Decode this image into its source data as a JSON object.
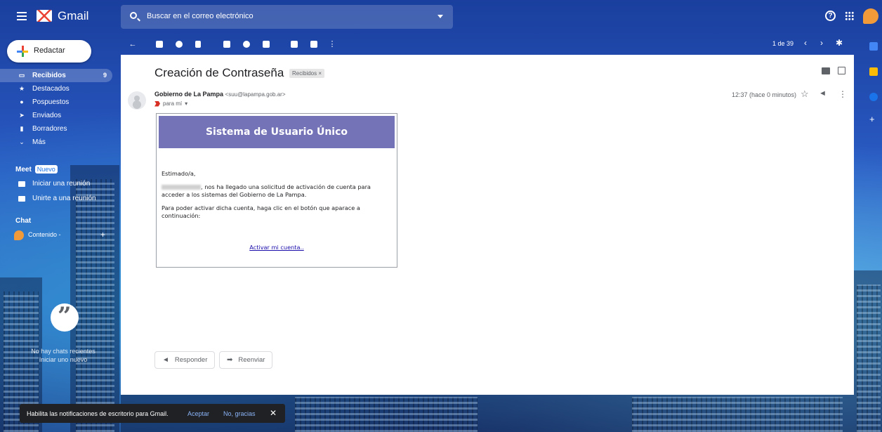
{
  "app": {
    "name": "Gmail"
  },
  "search": {
    "placeholder": "Buscar en el correo electrónico"
  },
  "sidebar": {
    "compose_label": "Redactar",
    "items": [
      {
        "label": "Recibidos",
        "count": "9",
        "icon": "inbox-icon"
      },
      {
        "label": "Destacados",
        "icon": "star-icon"
      },
      {
        "label": "Pospuestos",
        "icon": "clock-icon"
      },
      {
        "label": "Enviados",
        "icon": "send-icon"
      },
      {
        "label": "Borradores",
        "icon": "draft-icon"
      },
      {
        "label": "Más",
        "icon": "chevron-down-icon"
      }
    ],
    "meet": {
      "heading": "Meet",
      "badge": "Nuevo",
      "start": "Iniciar una reunión",
      "join": "Unirte a una reunión"
    },
    "chat": {
      "heading": "Chat",
      "user": "Contenido -",
      "add": "+",
      "empty": "No hay chats recientes",
      "start_new": "Iniciar uno nuevo"
    }
  },
  "toolbar": {
    "pager": "1 de 39",
    "prev": "‹",
    "next": "›"
  },
  "message": {
    "subject": "Creación de Contraseña",
    "label": "Recibidos ×",
    "sender_name": "Gobierno de La Pampa",
    "sender_email": "<suu@lapampa.gob.ar>",
    "recipient": "para mí",
    "time": "12:37 (hace 0 minutos)",
    "body_title": "Sistema de Usuario Único",
    "greeting": "Estimado/a,",
    "paragraph1": ", nos ha llegado una solicitud de activación de cuenta para acceder a los sistemas del Gobierno de La Pampa.",
    "paragraph2": "Para poder activar dicha cuenta, haga clic en el botón que aparace a continuación:",
    "link": "Activar mi cuenta.."
  },
  "actions": {
    "reply": "Responder",
    "forward": "Reenviar"
  },
  "snackbar": {
    "text": "Habilita las notificaciones de escritorio para Gmail.",
    "accept": "Aceptar",
    "decline": "No, gracias",
    "close": "✕"
  },
  "colors": {
    "header_purple": "#7473b7",
    "link": "#1a0dab"
  }
}
